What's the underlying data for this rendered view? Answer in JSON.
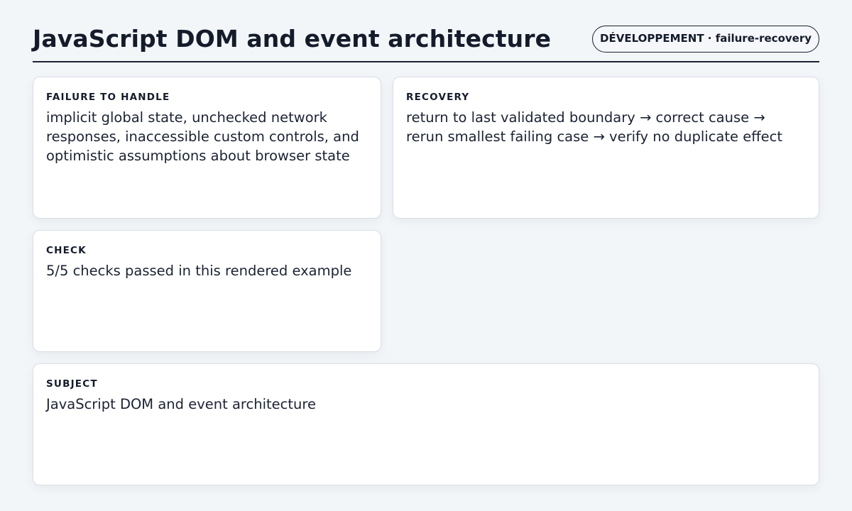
{
  "header": {
    "title": "JavaScript DOM and event architecture",
    "badge": "DÉVELOPPEMENT · failure-recovery"
  },
  "cards": {
    "failure": {
      "label": "FAILURE TO HANDLE",
      "text": "implicit global state, unchecked network responses, inaccessible custom controls, and optimistic assumptions about browser state"
    },
    "recovery": {
      "label": "RECOVERY",
      "text": "return to last validated boundary → correct cause → rerun smallest failing case → verify no duplicate effect"
    },
    "check": {
      "label": "CHECK",
      "text": "5/5 checks passed in this rendered example"
    },
    "subject": {
      "label": "SUBJECT",
      "text": "JavaScript DOM and event architecture"
    }
  }
}
